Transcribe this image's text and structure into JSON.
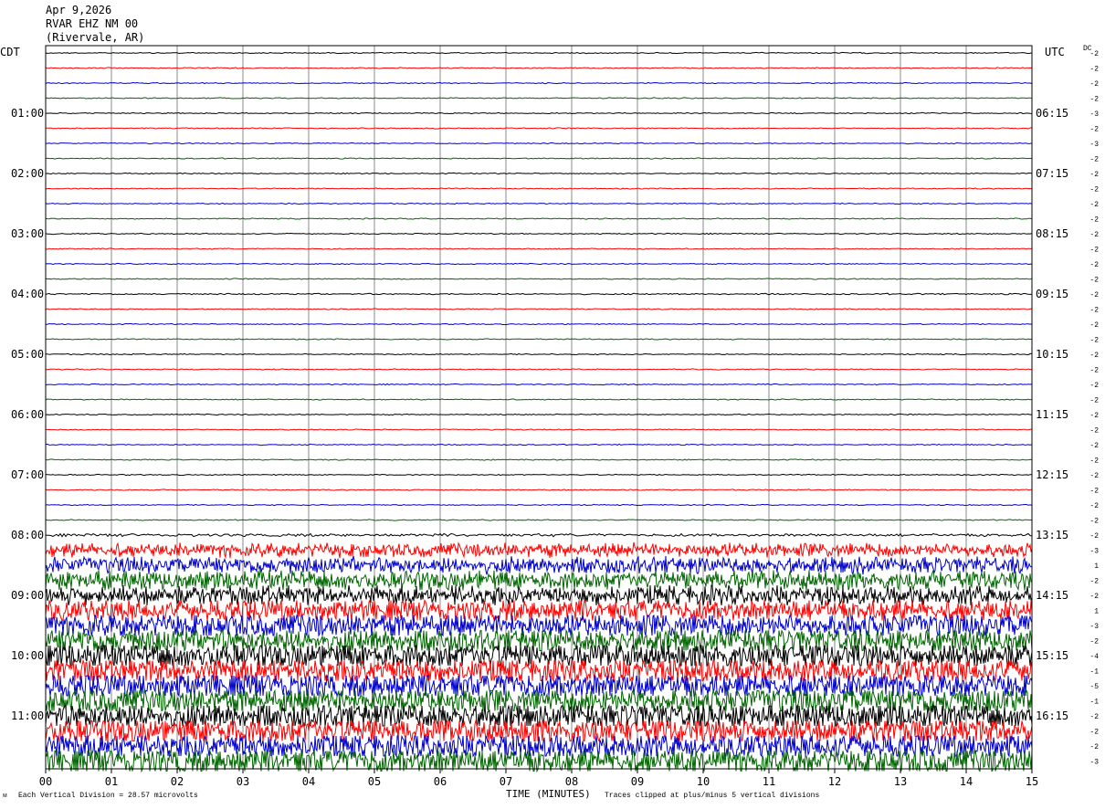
{
  "header": {
    "date": "Apr 9,2026",
    "station": "RVAR EHZ NM 00",
    "location": "(Rivervale, AR)"
  },
  "left_zone_label": "CDT",
  "right_zone_label": "UTC",
  "dc_label": "DC",
  "footer": {
    "vertical_division": "Each Vertical Division =   28.57 microvolts",
    "xlabel": "TIME (MINUTES)",
    "clip_note": "Traces clipped at plus/minus 5 vertical divisions",
    "corner_mark": "ᴹ"
  },
  "colors": {
    "trace_cycle": [
      "#000000",
      "#ff0000",
      "#0000cc",
      "#006600"
    ],
    "grid": "#888888"
  },
  "chart_data": {
    "type": "line",
    "title": "",
    "xlabel": "TIME (MINUTES)",
    "ylabel": "",
    "xlim": [
      0,
      15
    ],
    "x_ticks": [
      "00",
      "01",
      "02",
      "03",
      "04",
      "05",
      "06",
      "07",
      "08",
      "09",
      "10",
      "11",
      "12",
      "13",
      "14",
      "15"
    ],
    "left_hour_labels": [
      "01:00",
      "02:00",
      "03:00",
      "04:00",
      "05:00",
      "06:00",
      "07:00",
      "08:00",
      "09:00",
      "10:00",
      "11:00"
    ],
    "right_hour_labels": [
      "06:15",
      "07:15",
      "08:15",
      "09:15",
      "10:15",
      "11:15",
      "12:15",
      "13:15",
      "14:15",
      "15:15",
      "16:15"
    ],
    "trace_count": 48,
    "dc_offsets": [
      -2,
      -2,
      -2,
      -2,
      -3,
      -2,
      -3,
      -2,
      -2,
      -2,
      -2,
      -2,
      -2,
      -2,
      -2,
      -2,
      -2,
      -2,
      -2,
      -2,
      -2,
      -2,
      -2,
      -2,
      -2,
      -2,
      -2,
      -2,
      -2,
      -2,
      -2,
      -2,
      -2,
      -3,
      1,
      -2,
      -2,
      1,
      -3,
      -2,
      -4,
      -1,
      -5,
      -1,
      -2,
      -2,
      -2,
      -3
    ],
    "trace_amplitude_divisions": [
      0.2,
      0.2,
      0.2,
      0.2,
      0.2,
      0.2,
      0.2,
      0.2,
      0.2,
      0.2,
      0.2,
      0.2,
      0.2,
      0.2,
      0.2,
      0.2,
      0.25,
      0.2,
      0.2,
      0.2,
      0.2,
      0.2,
      0.2,
      0.2,
      0.2,
      0.2,
      0.2,
      0.2,
      0.2,
      0.2,
      0.2,
      0.2,
      0.5,
      2.5,
      3,
      3.5,
      3.5,
      4,
      4.5,
      4.5,
      5,
      5,
      5,
      5,
      5,
      5,
      5,
      5
    ],
    "clip_divisions": 5,
    "grid": true
  }
}
